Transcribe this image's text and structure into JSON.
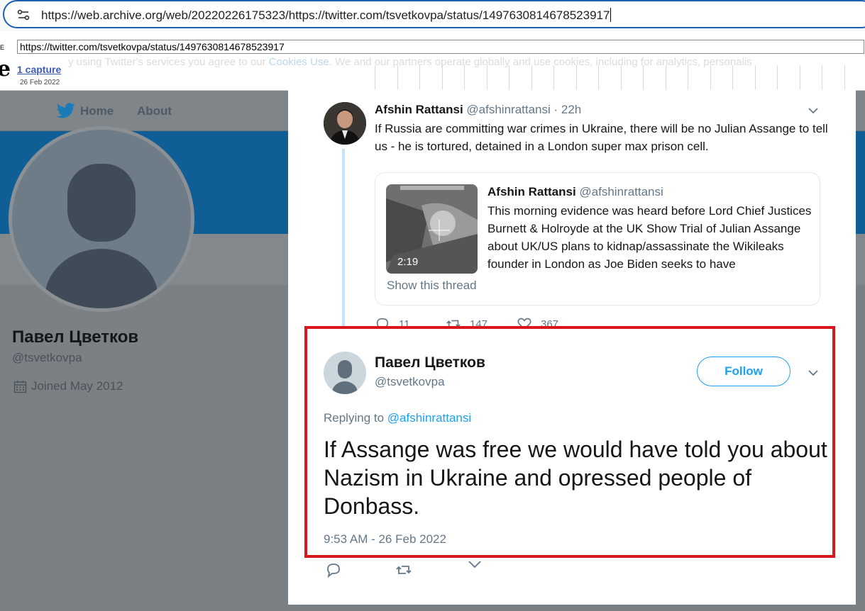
{
  "browser": {
    "address": "https://web.archive.org/web/20220226175323/https://twitter.com/tsvetkovpa/status/1497630814678523917"
  },
  "wayback": {
    "logo_fragment": "E",
    "logo_letter": "e",
    "url": "https://twitter.com/tsvetkovpa/status/1497630814678523917",
    "captures": "1 capture",
    "date": "26 Feb 2022",
    "cookie_text_before": "y using Twitter's services you agree to our ",
    "cookie_link": "Cookies Use",
    "cookie_text_after": ". We and our partners operate globally and use cookies, including for analytics, personalis"
  },
  "twitter_nav": {
    "home": "Home",
    "about": "About"
  },
  "profile": {
    "name": "Павел Цветков",
    "handle": "@tsvetkovpa",
    "joined": "Joined May 2012"
  },
  "parent_tweet": {
    "author": "Afshin Rattansi",
    "meta": "@afshinrattansi · 22h",
    "text": "If Russia are committing war crimes in Ukraine, there will be no Julian Assange to tell us - he is tortured, detained in a London super max prison cell.",
    "quote": {
      "author": "Afshin Rattansi",
      "handle": "@afshinrattansi",
      "text": "This morning evidence was heard before Lord Chief Justices Burnett & Holroyde at the UK Show Trial of Julian Assange about UK/US plans to kidnap/assassinate the Wikileaks founder in London as Joe Biden seeks to have",
      "duration": "2:19",
      "show_thread": "Show this thread"
    },
    "replies": "11",
    "retweets": "147",
    "likes": "367"
  },
  "main_tweet": {
    "author": "Павел Цветков",
    "handle": "@tsvetkovpa",
    "follow_label": "Follow",
    "replying_prefix": "Replying to ",
    "replying_mention": "@afshinrattansi",
    "text": "If Assange was free we would have told you about Nazism in Ukraine and opressed people of Donbass.",
    "timestamp": "9:53 AM - 26 Feb 2022"
  },
  "colors": {
    "twitter_blue": "#1da1f2",
    "highlight_red": "#d9161c",
    "overlay_gray": "#7b8085"
  },
  "icons": [
    "tune-icon",
    "twitter-bird-icon",
    "calendar-icon",
    "chevron-down-icon",
    "reply-icon",
    "retweet-icon",
    "like-icon",
    "default-avatar-icon"
  ]
}
